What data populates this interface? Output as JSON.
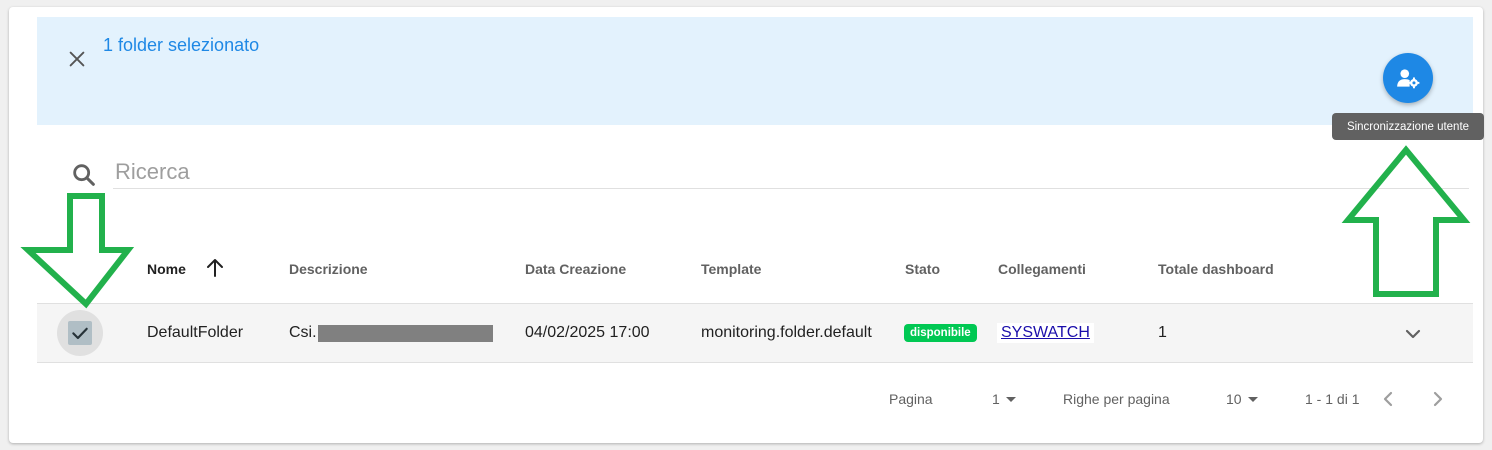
{
  "toolbar": {
    "selected_text": "1 folder selezionato",
    "action_tooltip": "Sincronizzazione utente"
  },
  "search": {
    "placeholder": "Ricerca"
  },
  "table": {
    "headers": {
      "nome": "Nome",
      "descrizione": "Descrizione",
      "data_creazione": "Data Creazione",
      "template": "Template",
      "stato": "Stato",
      "collegamenti": "Collegamenti",
      "totale_dashboard": "Totale dashboard"
    },
    "sort": {
      "column": "Nome",
      "direction": "ascending"
    },
    "rows": [
      {
        "selected": true,
        "nome": "DefaultFolder",
        "descrizione": "Csi.",
        "data_creazione": "04/02/2025 17:00",
        "template": "monitoring.folder.default",
        "stato": "disponibile",
        "collegamenti": "SYSWATCH",
        "totale_dashboard": "1"
      }
    ]
  },
  "pagination": {
    "page_label": "Pagina",
    "page_value": "1",
    "rows_label": "Righe per pagina",
    "rows_value": "10",
    "range": "1 - 1 di 1"
  },
  "colors": {
    "accent": "#1e88e5",
    "toolbar_bg": "#e3f2fd",
    "badge": "#00c853",
    "annotation_arrow": "#22b14c"
  },
  "icons": {
    "close": "close-icon",
    "fab": "user-sync-icon",
    "search": "search-icon",
    "sort": "arrow-up-icon",
    "checkbox": "check-icon",
    "expand": "chevron-down-icon",
    "prev": "chevron-left-icon",
    "next": "chevron-right-icon"
  }
}
